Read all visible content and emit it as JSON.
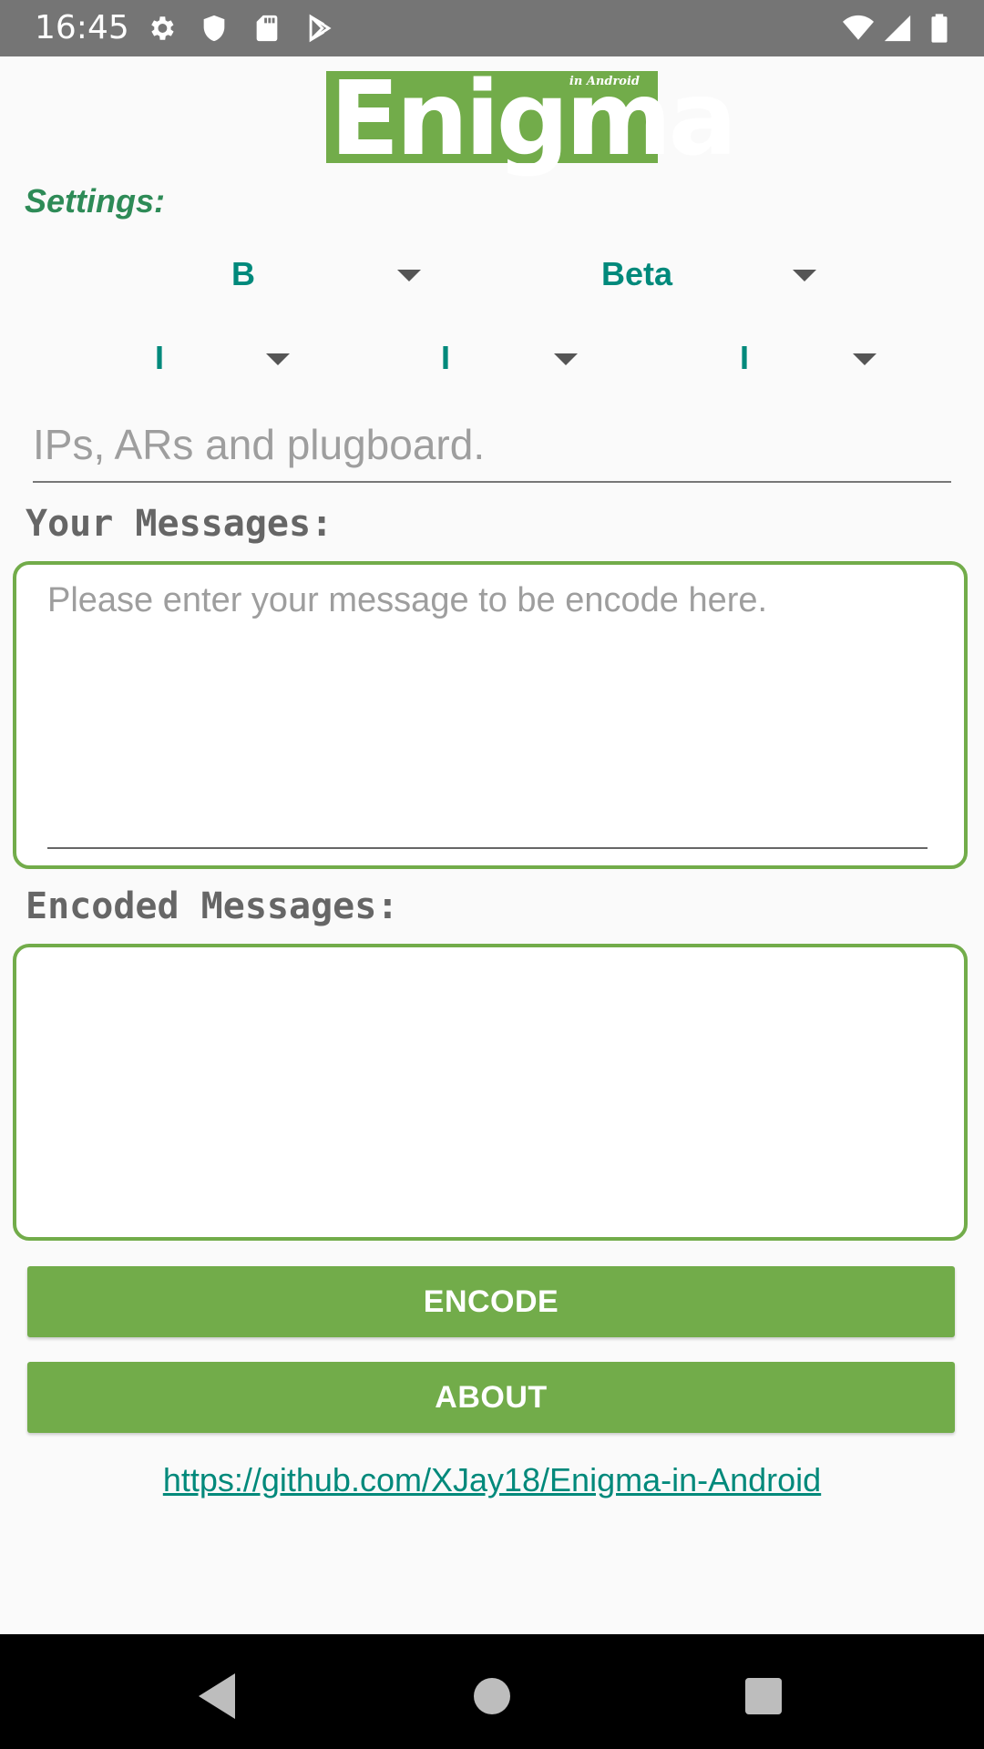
{
  "status_bar": {
    "time": "16:45",
    "icons": [
      "gear-icon",
      "shield-icon",
      "sd-card-icon",
      "play-store-icon",
      "wifi-icon",
      "signal-icon",
      "battery-icon"
    ]
  },
  "logo": {
    "title": "Enigma",
    "subtitle": "in Android"
  },
  "settings": {
    "label": "Settings:",
    "reflector": "B",
    "greek_rotor": "Beta",
    "rotors": [
      "I",
      "I",
      "I"
    ]
  },
  "ip_input": {
    "placeholder": "IPs, ARs and plugboard."
  },
  "your_messages": {
    "label": "Your Messages:",
    "placeholder": "Please enter your message to be encode here."
  },
  "encoded_messages": {
    "label": "Encoded Messages:"
  },
  "buttons": {
    "encode": "ENCODE",
    "about": "ABOUT"
  },
  "link": "https://github.com/XJay18/Enigma-in-Android",
  "colors": {
    "accent": "#72ac4a",
    "teal": "#00897b",
    "status_bar": "#757575"
  }
}
